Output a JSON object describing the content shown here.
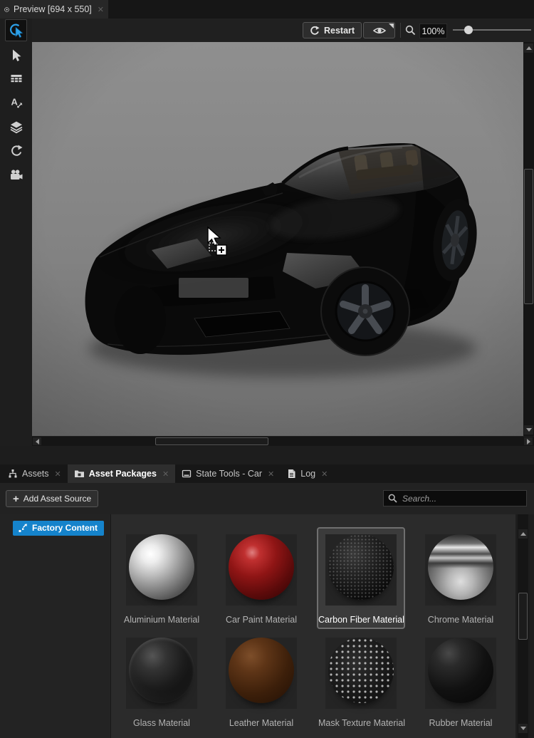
{
  "glyphs": {
    "close": "✕",
    "plus": "+"
  },
  "colors": {
    "accent_blue": "#1583cb",
    "tool_active_blue": "#2da0e8",
    "selection_border": "#6f6f6f"
  },
  "preview_tab": {
    "title": "Preview [694 x 550]"
  },
  "viewport_toolbar": {
    "restart_label": "Restart",
    "zoom_value": "100%"
  },
  "left_toolbar": {
    "tools": [
      {
        "icon": "pick-tool-icon",
        "active": true
      },
      {
        "icon": "select-arrow-icon",
        "active": false
      },
      {
        "icon": "table-view-icon",
        "active": false
      },
      {
        "icon": "text-translate-icon",
        "active": false
      },
      {
        "icon": "layers-icon",
        "active": false
      },
      {
        "icon": "redo-arrow-icon",
        "active": false
      },
      {
        "icon": "camera-icon",
        "active": false
      }
    ]
  },
  "bottom_tabs": [
    {
      "label": "Assets",
      "icon": "assets-tree-icon",
      "active": false
    },
    {
      "label": "Asset Packages",
      "icon": "folder-icon",
      "active": true
    },
    {
      "label": "State Tools - Car",
      "icon": "window-icon",
      "active": false
    },
    {
      "label": "Log",
      "icon": "document-icon",
      "active": false
    }
  ],
  "asset_toolbar": {
    "add_source_label": "Add Asset Source",
    "search_placeholder": "Search..."
  },
  "source_sidebar": {
    "items": [
      {
        "label": "Factory Content",
        "icon": "scatter-arrow-icon",
        "selected": true
      }
    ]
  },
  "materials": [
    {
      "name": "Aluminium Material",
      "style": "aluminium",
      "selected": false
    },
    {
      "name": "Car Paint Material",
      "style": "carpaint",
      "selected": false
    },
    {
      "name": "Carbon Fiber Material",
      "style": "carbonfiber",
      "selected": true
    },
    {
      "name": "Chrome Material",
      "style": "chrome",
      "selected": false
    },
    {
      "name": "Glass Material",
      "style": "glass",
      "selected": false
    },
    {
      "name": "Leather Material",
      "style": "leather",
      "selected": false
    },
    {
      "name": "Mask Texture Material",
      "style": "masktexture",
      "selected": false
    },
    {
      "name": "Rubber Material",
      "style": "rubber",
      "selected": false
    }
  ]
}
